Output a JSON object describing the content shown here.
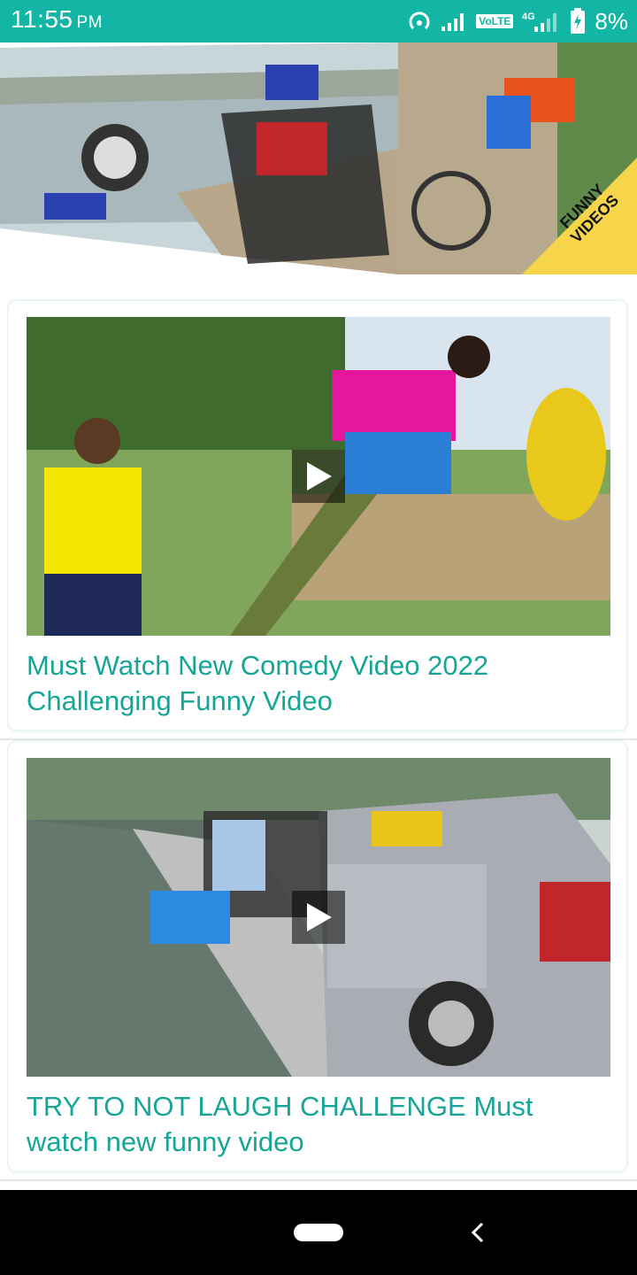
{
  "status_bar": {
    "time": "11:55",
    "ampm": "PM",
    "network": "VoLTE",
    "network_gen": "4G",
    "battery": "8%",
    "icons": [
      "hotspot-icon",
      "signal-icon",
      "signal-icon",
      "battery-charging-icon"
    ]
  },
  "banner": {
    "tag_line1": "FUNNY",
    "tag_line2": "VIDEOS"
  },
  "videos": [
    {
      "title": "Must Watch New Comedy Video 2022 Challenging Funny Video",
      "thumbnail_icon": "video-thumbnail",
      "play_icon": "play-icon"
    },
    {
      "title": "TRY TO NOT LAUGH CHALLENGE Must watch new funny video",
      "thumbnail_icon": "video-thumbnail",
      "play_icon": "play-icon"
    }
  ],
  "navbar": {
    "home_icon": "home-pill-icon",
    "back_icon": "back-chevron-icon"
  },
  "colors": {
    "accent": "#13b5a5",
    "title_text": "#16a597",
    "tag_yellow": "#f7d54a"
  }
}
